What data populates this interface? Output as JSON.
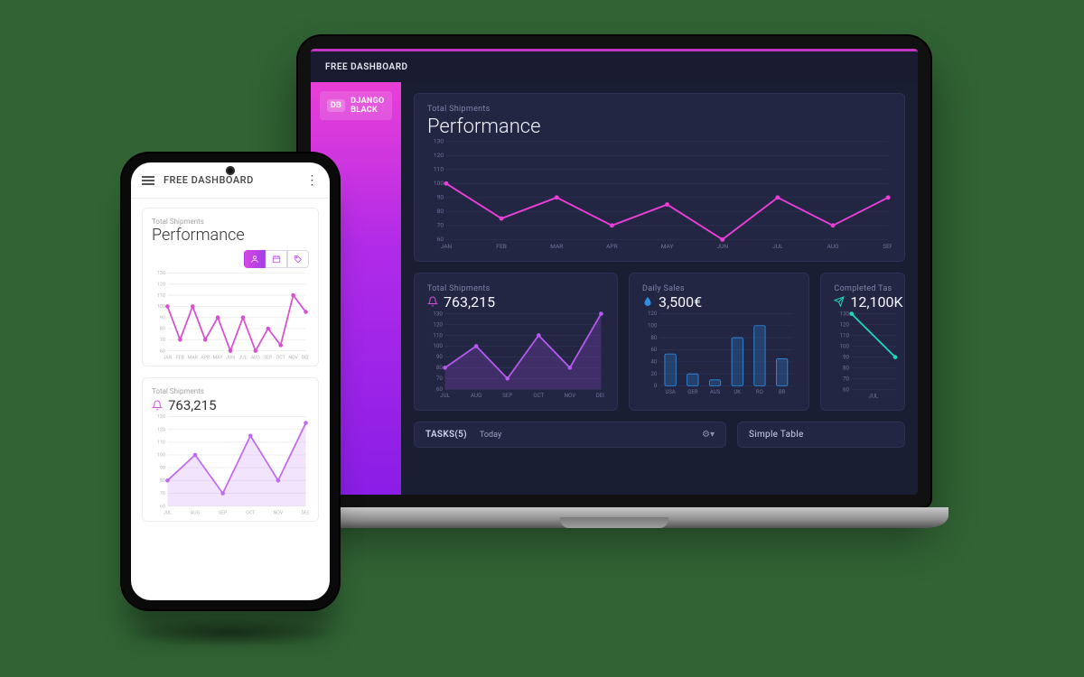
{
  "app_title": "FREE DASHBOARD",
  "sidebar": {
    "badge_short": "DB",
    "badge_label": "DJANGO BLACK"
  },
  "tasks": {
    "title": "TASKS(5)",
    "tab": "Today"
  },
  "simple_table_title": "Simple Table",
  "perf_card": {
    "subtitle": "Total Shipments",
    "title": "Performance"
  },
  "shipments_card": {
    "subtitle": "Total Shipments",
    "value": "763,215"
  },
  "sales_card": {
    "subtitle": "Daily Sales",
    "value": "3,500€"
  },
  "completed_card": {
    "subtitle": "Completed Tas",
    "value": "12,100K"
  },
  "colors": {
    "magenta": "#e93fd6",
    "purple_fill": "rgba(156, 70, 220, .25)",
    "blue": "#2f8fe7",
    "teal": "#19d7c0"
  },
  "chart_data": [
    {
      "id": "desktop_performance",
      "type": "line",
      "title": "Performance",
      "subtitle": "Total Shipments",
      "categories": [
        "JAN",
        "FEB",
        "MAR",
        "APR",
        "MAY",
        "JUN",
        "JUL",
        "AUG",
        "SEP"
      ],
      "y_ticks": [
        60,
        70,
        80,
        90,
        100,
        110,
        120,
        130
      ],
      "ylim": [
        60,
        130
      ],
      "values": [
        100,
        75,
        90,
        70,
        85,
        60,
        90,
        70,
        90
      ]
    },
    {
      "id": "desktop_shipments",
      "type": "area",
      "subtitle": "Total Shipments",
      "value_label": "763,215",
      "categories": [
        "JUL",
        "AUG",
        "SEP",
        "OCT",
        "NOV",
        "DEC"
      ],
      "y_ticks": [
        60,
        70,
        80,
        90,
        100,
        110,
        120,
        130
      ],
      "ylim": [
        60,
        130
      ],
      "values": [
        80,
        100,
        70,
        110,
        80,
        130
      ]
    },
    {
      "id": "desktop_sales",
      "type": "bar",
      "subtitle": "Daily Sales",
      "value_label": "3,500€",
      "categories": [
        "USA",
        "GER",
        "AUS",
        "UK",
        "RO",
        "BR"
      ],
      "y_ticks": [
        0,
        20,
        40,
        60,
        80,
        100,
        120
      ],
      "ylim": [
        0,
        120
      ],
      "values": [
        53,
        20,
        10,
        80,
        100,
        45
      ]
    },
    {
      "id": "desktop_completed",
      "type": "line",
      "subtitle": "Completed Tasks",
      "value_label": "12,100K",
      "categories": [
        "JUL"
      ],
      "y_ticks": [
        60,
        70,
        80,
        90,
        100,
        110,
        120,
        130
      ],
      "ylim": [
        60,
        130
      ],
      "values": [
        130,
        90
      ]
    },
    {
      "id": "mobile_performance",
      "type": "line",
      "title": "Performance",
      "subtitle": "Total Shipments",
      "categories": [
        "JAN",
        "FEB",
        "MAR",
        "APR",
        "MAY",
        "JUN",
        "JUL",
        "AUG",
        "SEP",
        "OCT",
        "NOV",
        "DEC"
      ],
      "y_ticks": [
        60,
        70,
        80,
        90,
        100,
        110,
        120,
        130
      ],
      "ylim": [
        60,
        130
      ],
      "values": [
        100,
        70,
        100,
        70,
        90,
        60,
        90,
        60,
        80,
        65,
        110,
        95
      ]
    },
    {
      "id": "mobile_shipments",
      "type": "area",
      "subtitle": "Total Shipments",
      "value_label": "763,215",
      "categories": [
        "JUL",
        "AUG",
        "SEP",
        "OCT",
        "NOV",
        "DEC"
      ],
      "y_ticks": [
        60,
        70,
        80,
        90,
        100,
        110,
        120,
        130
      ],
      "ylim": [
        60,
        130
      ],
      "values": [
        80,
        100,
        70,
        115,
        80,
        125
      ]
    }
  ]
}
